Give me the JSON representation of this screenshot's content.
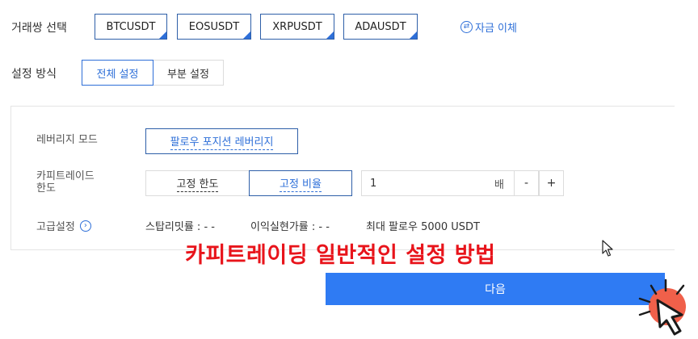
{
  "pair_row": {
    "label": "거래쌍 선택",
    "pairs": [
      "BTCUSDT",
      "EOSUSDT",
      "XRPUSDT",
      "ADAUSDT"
    ],
    "transfer_label": "자금 이체"
  },
  "mode_row": {
    "label": "설정 방식",
    "options": [
      "전체 설정",
      "부분 설정"
    ],
    "selected": "전체 설정"
  },
  "leverage": {
    "label": "레버리지 모드",
    "value": "팔로우 포지션 레버리지"
  },
  "limit": {
    "label_line1": "카피트레이드",
    "label_line2": "한도",
    "options": [
      "고정 한도",
      "고정 비율"
    ],
    "selected": "고정 비율",
    "multiplier_value": "1",
    "multiplier_unit": "배",
    "minus": "-",
    "plus": "+"
  },
  "advanced": {
    "label": "고급설정",
    "stop_loss": "스탑리밋률 : - -",
    "take_profit": "이익실현가률 : - -",
    "max_follow": "최대 팔로우 5000 USDT"
  },
  "overlay_title": "카피트레이딩 일반적인 설정 방법",
  "next_button": "다음",
  "colors": {
    "accent": "#2e6fd8",
    "primary_button": "#2f7bf3",
    "overlay_text": "#e8141b",
    "cursor_highlight": "#f0604a"
  }
}
